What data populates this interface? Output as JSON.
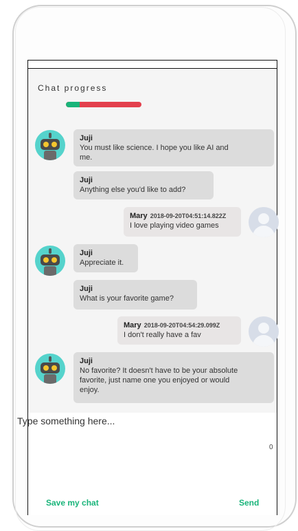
{
  "progress": {
    "title": "Chat progress",
    "fraction": 0.18,
    "fill_color": "#19b47a",
    "remaining_color": "#e3404d"
  },
  "messages": [
    {
      "from": "bot",
      "sender": "Juji",
      "lines": [
        "You must like science. I hope you like AI and",
        "me."
      ]
    },
    {
      "from": "bot",
      "sender": "Juji",
      "lines": [
        "Anything else you'd like to add?"
      ]
    },
    {
      "from": "user",
      "sender": "Mary",
      "timestamp": "2018-09-20T04:51:14.822Z",
      "lines": [
        "I love playing video games"
      ]
    },
    {
      "from": "bot",
      "sender": "Juji",
      "lines": [
        "Appreciate it."
      ]
    },
    {
      "from": "bot",
      "sender": "Juji",
      "lines": [
        "What is your favorite game?"
      ]
    },
    {
      "from": "user",
      "sender": "Mary",
      "timestamp": "2018-09-20T04:54:29.099Z",
      "lines": [
        "I don't really have a fav"
      ]
    },
    {
      "from": "bot",
      "sender": "Juji",
      "lines": [
        "No favorite? It doesn't have to be your absolute",
        "favorite, just name one you enjoyed or would",
        "enjoy."
      ]
    }
  ],
  "input": {
    "placeholder": "Type something here...",
    "char_count": "0"
  },
  "footer": {
    "save_label": "Save my chat",
    "send_label": "Send",
    "accent_color": "#19b47a"
  },
  "icons": {
    "bot_avatar": "robot-icon",
    "user_avatar": "user-silhouette-icon"
  }
}
